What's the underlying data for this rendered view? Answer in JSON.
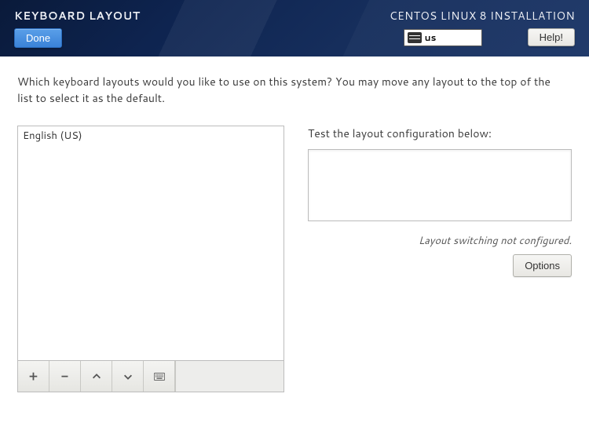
{
  "header": {
    "page_title": "KEYBOARD LAYOUT",
    "done_label": "Done",
    "installer_title": "CENTOS LINUX 8 INSTALLATION",
    "keyboard_indicator": "us",
    "help_label": "Help!"
  },
  "main": {
    "prompt": "Which keyboard layouts would you like to use on this system?  You may move any layout to the top of the list to select it as the default.",
    "layouts": [
      {
        "name": "English (US)",
        "selected": false
      }
    ],
    "test_label": "Test the layout configuration below:",
    "test_value": "",
    "switch_note": "Layout switching not configured.",
    "options_label": "Options"
  },
  "toolbar": {
    "add_title": "Add layout",
    "remove_title": "Remove layout",
    "moveup_title": "Move up",
    "movedown_title": "Move down",
    "preview_title": "Preview layout"
  }
}
